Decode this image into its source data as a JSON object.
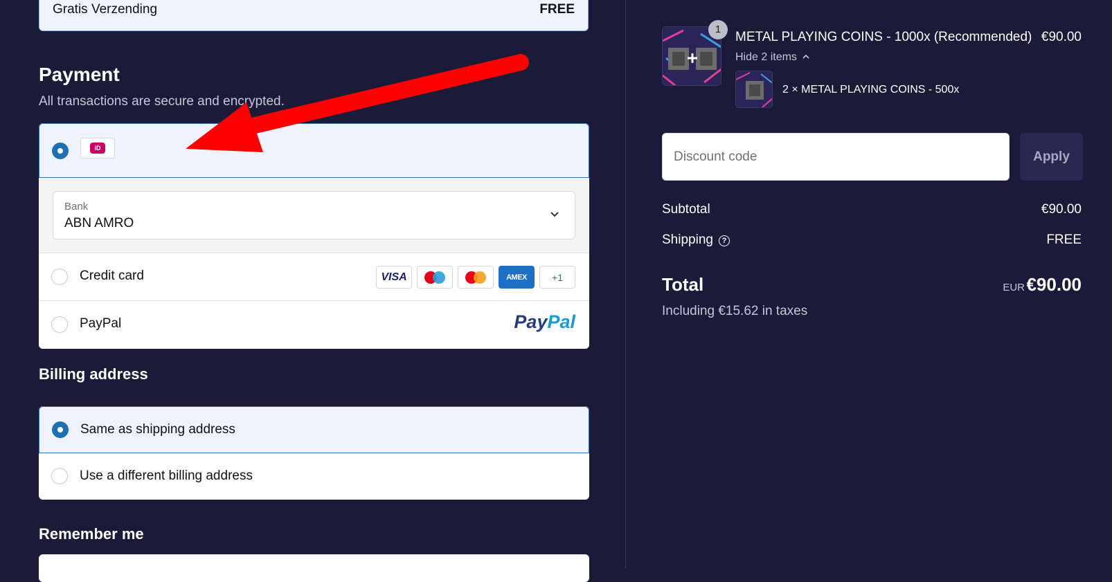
{
  "shipping_method": {
    "label": "Gratis Verzending",
    "value": "FREE"
  },
  "payment": {
    "title": "Payment",
    "subtitle": "All transactions are secure and encrypted.",
    "ideal_badge": "iD",
    "bank_label": "Bank",
    "bank_value": "ABN AMRO",
    "credit_card_label": "Credit card",
    "cards": [
      "VISA",
      "AMEX",
      "+1"
    ],
    "paypal_label": "PayPal",
    "paypal_logo_p1": "Pay",
    "paypal_logo_p2": "Pal"
  },
  "billing": {
    "title": "Billing address",
    "same_label": "Same as shipping address",
    "different_label": "Use a different billing address"
  },
  "remember": {
    "title": "Remember me"
  },
  "order": {
    "quantity_badge": "1",
    "product_name": "METAL PLAYING COINS - 1000x (Recommended)",
    "product_price": "€90.00",
    "hide_items": "Hide 2 items",
    "sub_item": "2 × METAL PLAYING COINS - 500x"
  },
  "discount": {
    "placeholder": "Discount code",
    "apply_label": "Apply"
  },
  "summary": {
    "subtotal_label": "Subtotal",
    "subtotal_value": "€90.00",
    "shipping_label": "Shipping",
    "shipping_value": "FREE",
    "total_label": "Total",
    "total_currency": "EUR",
    "total_value": "€90.00",
    "tax_note": "Including €15.62 in taxes"
  },
  "colors": {
    "background": "#1b1a38",
    "accent": "#1f6fb3",
    "selected_bg": "#eef3fd",
    "arrow": "#ff0000"
  }
}
